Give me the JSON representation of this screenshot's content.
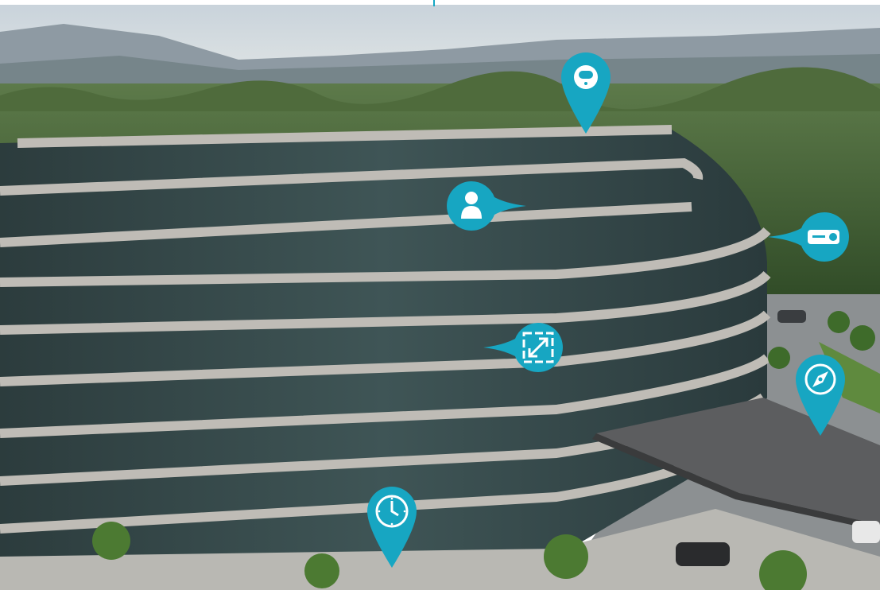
{
  "scene": {
    "accent_color": "#17a6c2",
    "pin_icon_color": "#ffffff"
  },
  "hotspots": [
    {
      "icon": "smart-sensor-icon",
      "direction": "down"
    },
    {
      "icon": "user-icon",
      "direction": "right"
    },
    {
      "icon": "badge-card-icon",
      "direction": "left"
    },
    {
      "icon": "expand-arrow-icon",
      "direction": "left"
    },
    {
      "icon": "compass-icon",
      "direction": "down"
    },
    {
      "icon": "clock-icon",
      "direction": "down"
    }
  ]
}
